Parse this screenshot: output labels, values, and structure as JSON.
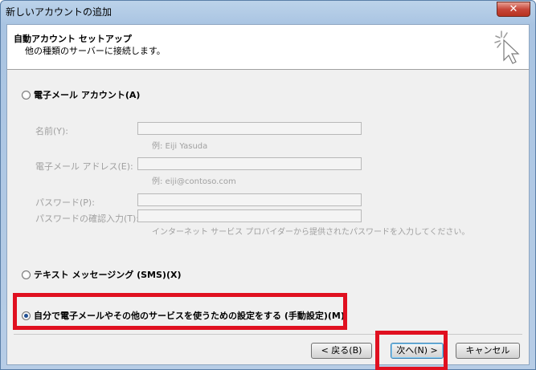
{
  "window": {
    "title": "新しいアカウントの追加",
    "close_label": "✕"
  },
  "header": {
    "title": "自動アカウント セットアップ",
    "subtitle": "他の種類のサーバーに接続します。",
    "icon": "cursor-sparkle-icon"
  },
  "options": {
    "email_account": "電子メール アカウント(A)",
    "sms": "テキスト メッセージング (SMS)(X)",
    "manual": "自分で電子メールやその他のサービスを使うための設定をする (手動設定)(M)",
    "selected": "manual"
  },
  "form": {
    "name_label": "名前(Y):",
    "name_value": "",
    "name_hint": "例: Eiji Yasuda",
    "email_label": "電子メール アドレス(E):",
    "email_value": "",
    "email_hint": "例: eiji@contoso.com",
    "password_label": "パスワード(P):",
    "password_value": "",
    "confirm_label": "パスワードの確認入力(T):",
    "confirm_value": "",
    "password_hint": "インターネット サービス プロバイダーから提供されたパスワードを入力してください。"
  },
  "buttons": {
    "back": "< 戻る(B)",
    "next": "次へ(N) >",
    "cancel": "キャンセル"
  },
  "colors": {
    "highlight": "#e01020"
  }
}
